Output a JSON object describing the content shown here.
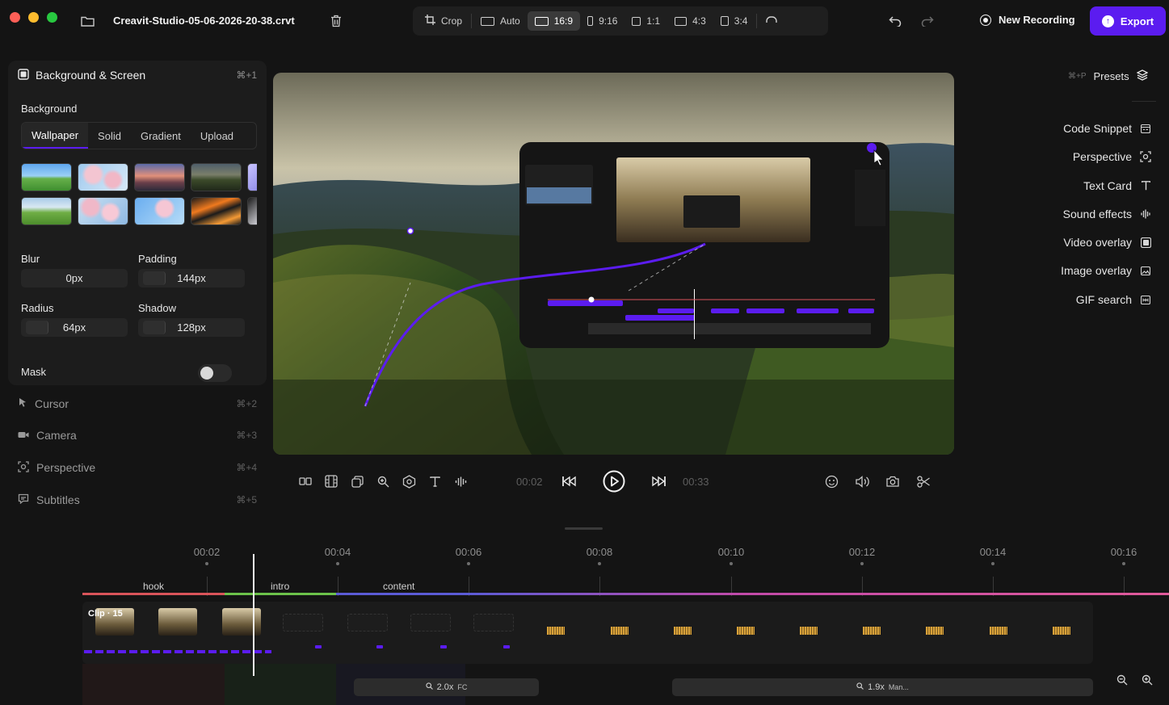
{
  "window": {
    "filename": "Creavit-Studio-05-06-2026-20-38.crvt"
  },
  "aspect": {
    "items": [
      {
        "label": "Crop",
        "icon": "crop-icon"
      },
      {
        "label": "Auto",
        "icon": "aspect-auto-icon"
      },
      {
        "label": "16:9",
        "icon": "aspect-16-9-icon",
        "active": true
      },
      {
        "label": "9:16",
        "icon": "aspect-9-16-icon"
      },
      {
        "label": "1:1",
        "icon": "aspect-1-1-icon"
      },
      {
        "label": "4:3",
        "icon": "aspect-4-3-icon"
      },
      {
        "label": "3:4",
        "icon": "aspect-3-4-icon"
      }
    ]
  },
  "header": {
    "new_recording": "New Recording",
    "export": "Export"
  },
  "left_panel": {
    "title": "Background & Screen",
    "shortcut": "⌘+1",
    "background_label": "Background",
    "tabs": [
      "Wallpaper",
      "Solid",
      "Gradient",
      "Upload"
    ],
    "active_tab": "Wallpaper",
    "blur_label": "Blur",
    "blur_value": "0px",
    "padding_label": "Padding",
    "padding_value": "144px",
    "radius_label": "Radius",
    "radius_value": "64px",
    "shadow_label": "Shadow",
    "shadow_value": "128px",
    "mask_label": "Mask",
    "mask_enabled": false
  },
  "nav": [
    {
      "label": "Cursor",
      "shortcut": "⌘+2",
      "icon": "cursor-icon"
    },
    {
      "label": "Camera",
      "shortcut": "⌘+3",
      "icon": "camera-icon"
    },
    {
      "label": "Perspective",
      "shortcut": "⌘+4",
      "icon": "perspective-icon"
    },
    {
      "label": "Subtitles",
      "shortcut": "⌘+5",
      "icon": "subtitles-icon"
    }
  ],
  "player": {
    "current_time": "00:02",
    "total_time": "00:33"
  },
  "right_panel": {
    "presets_shortcut": "⌘+P",
    "presets_label": "Presets",
    "tools": [
      {
        "label": "Code Snippet",
        "icon": "code-snippet-icon"
      },
      {
        "label": "Perspective",
        "icon": "perspective-icon"
      },
      {
        "label": "Text Card",
        "icon": "text-card-icon"
      },
      {
        "label": "Sound effects",
        "icon": "sound-effects-icon"
      },
      {
        "label": "Video overlay",
        "icon": "video-overlay-icon"
      },
      {
        "label": "Image overlay",
        "icon": "image-overlay-icon"
      },
      {
        "label": "GIF search",
        "icon": "gif-search-icon"
      }
    ]
  },
  "timeline": {
    "ticks": [
      "00:02",
      "00:04",
      "00:06",
      "00:08",
      "00:10",
      "00:12",
      "00:14",
      "00:16"
    ],
    "segments": [
      {
        "label": "hook",
        "color": "#d9545a"
      },
      {
        "label": "intro",
        "color": "#6cc24a"
      },
      {
        "label": "content",
        "color": "#5b5bd6"
      }
    ],
    "clip_label": "Clip · 15",
    "zooms": [
      {
        "value": "2.0x",
        "mode": "FC"
      },
      {
        "value": "1.9x",
        "mode": "Man..."
      }
    ]
  },
  "colors": {
    "accent": "#5b1cf0",
    "panel": "#1c1c1c",
    "background": "#141414"
  }
}
